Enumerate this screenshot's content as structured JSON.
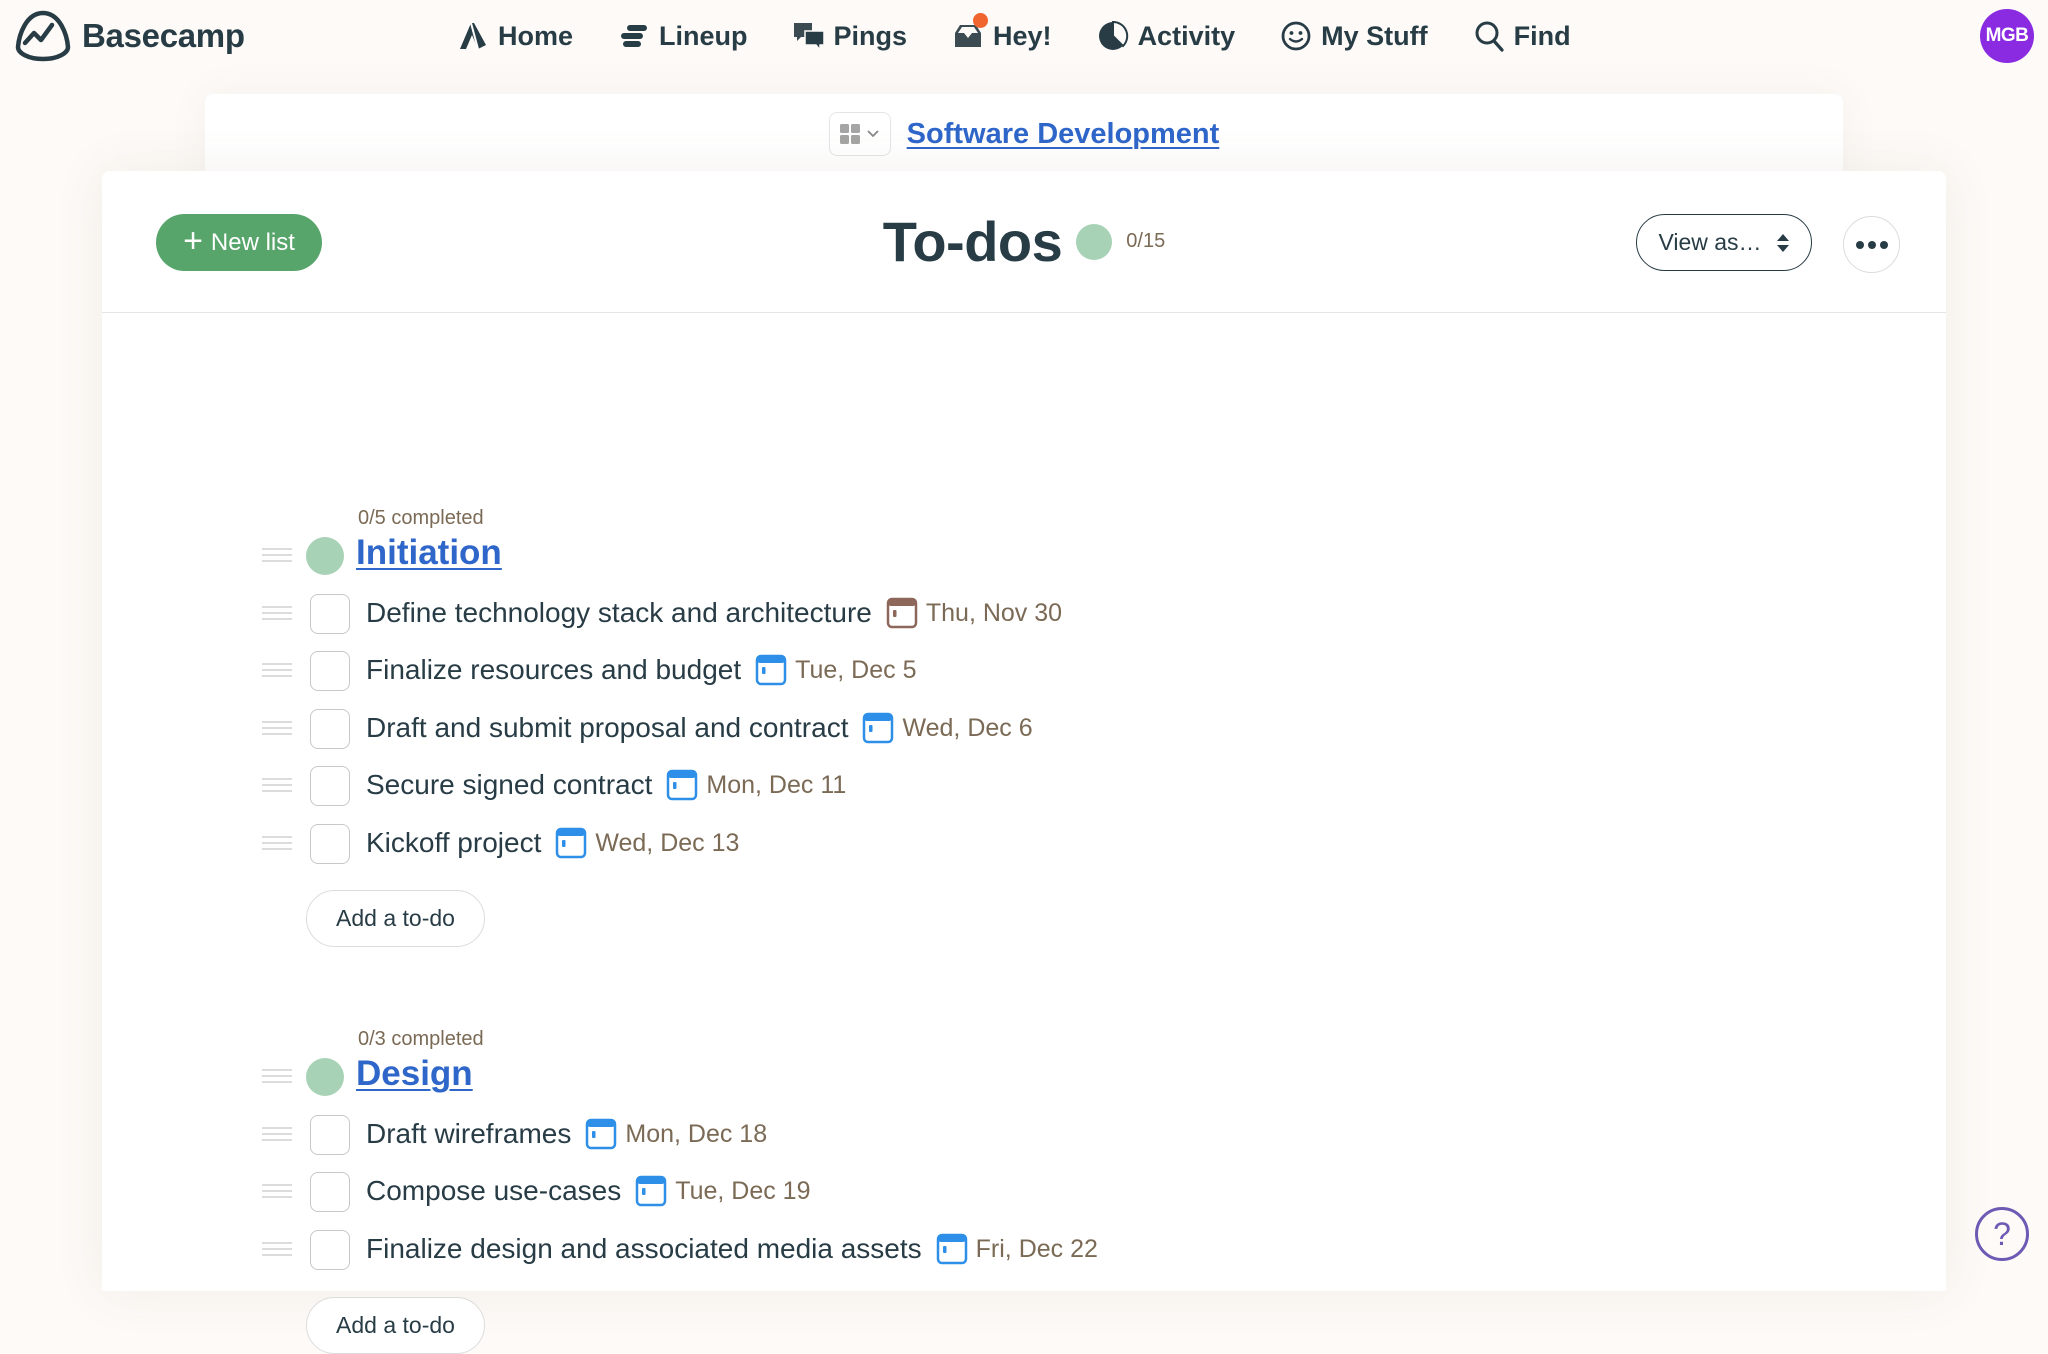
{
  "app": {
    "brand_name": "Basecamp",
    "brand_icon": "basecamp-logo-icon"
  },
  "nav": {
    "items": [
      {
        "label": "Home",
        "icon": "home-icon"
      },
      {
        "label": "Lineup",
        "icon": "lineup-icon"
      },
      {
        "label": "Pings",
        "icon": "pings-icon"
      },
      {
        "label": "Hey!",
        "icon": "hey-inbox-icon",
        "has_notification": true
      },
      {
        "label": "Activity",
        "icon": "activity-icon"
      },
      {
        "label": "My Stuff",
        "icon": "my-stuff-icon"
      },
      {
        "label": "Find",
        "icon": "search-icon"
      }
    ],
    "avatar_initials": "MGB",
    "avatar_color": "#8a2be2",
    "notification_color": "#f0642d"
  },
  "project": {
    "title": "Software Development",
    "switcher_icon": "grid-icon"
  },
  "page": {
    "title": "To-dos",
    "progress": "0/15",
    "progress_fraction": 0,
    "new_list_label": "New list",
    "view_as_label": "View as…",
    "more_icon": "ellipsis-icon"
  },
  "todolists": [
    {
      "title": "Initiation",
      "completed_text": "0/5 completed",
      "progress_fraction": 0,
      "add_label": "Add a to-do",
      "todos": [
        {
          "text": "Define technology stack and architecture",
          "due": "Thu, Nov 30",
          "overdue": true
        },
        {
          "text": "Finalize resources and budget",
          "due": "Tue, Dec 5",
          "overdue": false
        },
        {
          "text": "Draft and submit proposal and contract",
          "due": "Wed, Dec 6",
          "overdue": false
        },
        {
          "text": "Secure signed contract",
          "due": "Mon, Dec 11",
          "overdue": false
        },
        {
          "text": "Kickoff project",
          "due": "Wed, Dec 13",
          "overdue": false
        }
      ]
    },
    {
      "title": "Design",
      "completed_text": "0/3 completed",
      "progress_fraction": 0,
      "add_label": "Add a to-do",
      "todos": [
        {
          "text": "Draft wireframes",
          "due": "Mon, Dec 18",
          "overdue": false
        },
        {
          "text": "Compose use-cases",
          "due": "Tue, Dec 19",
          "overdue": false
        },
        {
          "text": "Finalize design and associated media assets",
          "due": "Fri, Dec 22",
          "overdue": false
        }
      ]
    }
  ],
  "colors": {
    "accent_green": "#57a56b",
    "progress_green": "#a8d2b5",
    "link_blue": "#2f66c9",
    "due_text": "#7b6a55",
    "calendar_blue": "#2d8fe8",
    "calendar_overdue": "#8c675a",
    "help_purple": "#6b5bb5"
  },
  "help": {
    "icon": "help-icon",
    "glyph": "?"
  }
}
